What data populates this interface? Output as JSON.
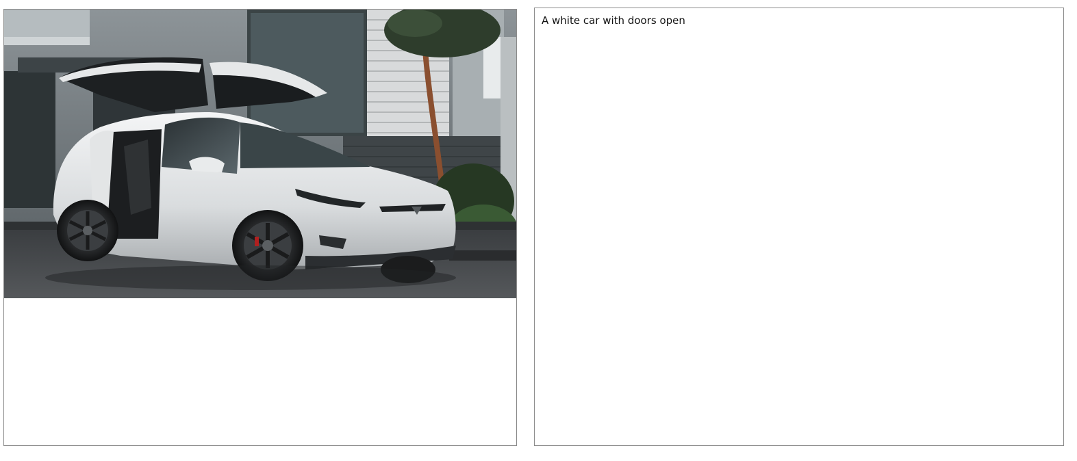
{
  "image_viewer": {
    "subject": "A white SUV with falcon-wing rear doors and front door open, parked on a street in front of a building with a tree"
  },
  "caption_box": {
    "text": "A white car with doors open"
  }
}
